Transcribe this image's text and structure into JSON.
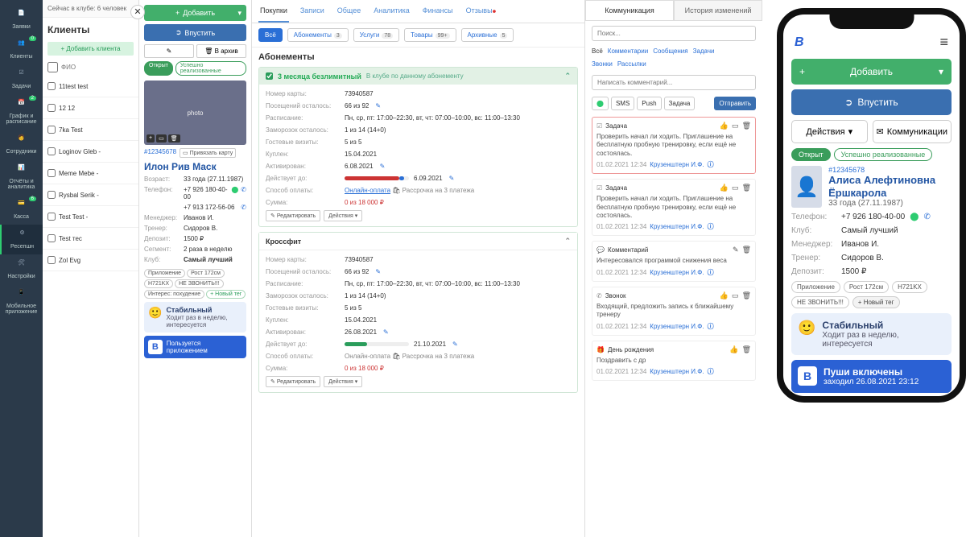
{
  "sidebar": {
    "items": [
      {
        "label": "Заявки",
        "badge": ""
      },
      {
        "label": "Клиенты",
        "badge": "0"
      },
      {
        "label": "Задачи",
        "badge": ""
      },
      {
        "label": "График и расписание",
        "badge": "2"
      },
      {
        "label": "Сотрудники",
        "badge": ""
      },
      {
        "label": "Отчёты и аналитика",
        "badge": ""
      },
      {
        "label": "Касса",
        "badge": "6"
      },
      {
        "label": "Ресепшн",
        "badge": ""
      },
      {
        "label": "Настройки",
        "badge": ""
      },
      {
        "label": "Мобильное приложение",
        "badge": ""
      }
    ]
  },
  "club_line": "Сейчас в клубе: 6 человек",
  "clients": {
    "title": "Клиенты",
    "add_btn": "+ Добавить клиента",
    "fio_label": "ФИО",
    "list": [
      "11test test",
      "12 12",
      "7ka Test",
      "Loginov Gleb -",
      "Meme Mebe -",
      "Rysbal Serik -",
      "Test Test -",
      "Test тес",
      "Zol Evg"
    ]
  },
  "profile": {
    "add": "Добавить",
    "admit": "Впустить",
    "archive_btn": "В архив",
    "status_open": "Открыт",
    "status_impl": "Успешно реализованные",
    "id": "#12345678",
    "bind_card": "Привязать карту",
    "name": "Илон Рив Маск",
    "kv": [
      {
        "k": "Возраст:",
        "v": "33 года (27.11.1987)"
      },
      {
        "k": "Телефон:",
        "v": "+7 926 180-40-00"
      },
      {
        "k": "",
        "v": "+7 913 172-56-06"
      },
      {
        "k": "Менеджер:",
        "v": "Иванов И."
      },
      {
        "k": "Тренер:",
        "v": "Сидоров В."
      },
      {
        "k": "Депозит:",
        "v": "1500 ₽"
      },
      {
        "k": "Сегмент:",
        "v": "2 раза в неделю"
      },
      {
        "k": "Клуб:",
        "v": "Самый лучший"
      }
    ],
    "tags": [
      "Приложение",
      "Рост 172см",
      "H721KX",
      "НЕ ЗВОНИТЬ!!!",
      "Интерес: похудение"
    ],
    "add_tag": "+ Новый тег",
    "status_card": {
      "title": "Стабильный",
      "sub": "Ходит раз в неделю, интересуется"
    },
    "app_card": {
      "title": "Пользуется приложением"
    }
  },
  "center": {
    "tabs": [
      "Покупки",
      "Записи",
      "Общее",
      "Аналитика",
      "Финансы",
      "Отзывы"
    ],
    "pills": [
      {
        "l": "Всё",
        "c": ""
      },
      {
        "l": "Абонементы",
        "c": "3"
      },
      {
        "l": "Услуги",
        "c": "78"
      },
      {
        "l": "Товары",
        "c": "99+"
      },
      {
        "l": "Архивные",
        "c": "5"
      }
    ],
    "section": "Абонементы",
    "abon1": {
      "title": "3 месяца безлимитный",
      "sub": "В клубе по данному абонементу",
      "rows": [
        {
          "k": "Номер карты:",
          "v": "73940587"
        },
        {
          "k": "Посещений осталось:",
          "v": "66 из 92"
        },
        {
          "k": "Расписание:",
          "v": "Пн, ср, пт: 17:00–22:30, вт, чт: 07:00–10:00, вс: 11:00–13:30"
        },
        {
          "k": "Заморозок осталось:",
          "v": "1 из 14 (14+0)"
        },
        {
          "k": "Гостевые визиты:",
          "v": "5 из 5"
        },
        {
          "k": "Куплен:",
          "v": "15.04.2021"
        },
        {
          "k": "Активирован:",
          "v": "6.08.2021"
        },
        {
          "k": "Действует до:",
          "v": "6.09.2021"
        },
        {
          "k": "Способ оплаты:",
          "v": "Онлайн-оплата",
          "extra": "Рассрочка на 3 платежа"
        },
        {
          "k": "Сумма:",
          "v": "0 из 18 000 ₽"
        }
      ],
      "edit": "Редактировать",
      "actions": "Действия"
    },
    "abon2": {
      "title": "Кроссфит",
      "rows": [
        {
          "k": "Номер карты:",
          "v": "73940587"
        },
        {
          "k": "Посещений осталось:",
          "v": "66 из 92"
        },
        {
          "k": "Расписание:",
          "v": "Пн, ср, пт: 17:00–22:30, вт, чт: 07:00–10:00, вс: 11:00–13:30"
        },
        {
          "k": "Заморозок осталось:",
          "v": "1 из 14 (14+0)"
        },
        {
          "k": "Гостевые визиты:",
          "v": "5 из 5"
        },
        {
          "k": "Куплен:",
          "v": "15.04.2021"
        },
        {
          "k": "Активирован:",
          "v": "26.08.2021"
        },
        {
          "k": "Действует до:",
          "v": "21.10.2021"
        },
        {
          "k": "Способ оплаты:",
          "v": "Онлайн-оплата",
          "extra": "Рассрочка на 3 платежа"
        },
        {
          "k": "Сумма:",
          "v": "0 из 18 000 ₽"
        }
      ],
      "edit": "Редактировать",
      "actions": "Действия"
    }
  },
  "right": {
    "tabs": [
      "Коммуникация",
      "История изменений"
    ],
    "search_ph": "Поиск...",
    "filters1": [
      "Всё",
      "Комментарии",
      "Сообщения",
      "Задачи"
    ],
    "filters2": [
      "Звонки",
      "Рассылки"
    ],
    "comment_ph": "Написать комментарий...",
    "sendopts": [
      "SMS",
      "Push",
      "Задача"
    ],
    "send": "Отправить",
    "feed": [
      {
        "type": "Задача",
        "body": "Проверить начал ли ходить. Приглашение на бесплатную пробную тренировку, если ещё не состоялась.",
        "meta": "01.02.2021 12:34",
        "who": "Крузенштерн И.Ф.",
        "hl": true
      },
      {
        "type": "Задача",
        "body": "Проверить начал ли ходить. Приглашение на бесплатную пробную тренировку, если ещё не состоялась.",
        "meta": "01.02.2021 12:34",
        "who": "Крузенштерн И.Ф."
      },
      {
        "type": "Комментарий",
        "body": "Интересовался программой снижения веса",
        "meta": "01.02.2021 12:34",
        "who": "Крузенштерн И.Ф."
      },
      {
        "type": "Звонок",
        "body": "Входящий, предложить запись к ближайшему тренеру",
        "meta": "01.02.2021 12:34",
        "who": "Крузенштерн И.Ф."
      },
      {
        "type": "День рождения",
        "body": "Поздравить с др",
        "meta": "01.02.2021 12:34",
        "who": "Крузенштерн И.Ф."
      }
    ]
  },
  "phone": {
    "add": "Добавить",
    "admit": "Впустить",
    "actions": "Действия",
    "comm": "Коммуникации",
    "status_open": "Открыт",
    "status_impl": "Успешно реализованные",
    "id": "#12345678",
    "name": "Алиса Алефтиновна Ёршкарола",
    "age": "33 года (27.11.1987)",
    "kv": [
      {
        "k": "Телефон:",
        "v": "+7 926 180-40-00"
      },
      {
        "k": "Клуб:",
        "v": "Самый лучший"
      },
      {
        "k": "Менеджер:",
        "v": "Иванов И."
      },
      {
        "k": "Тренер:",
        "v": "Сидоров В."
      },
      {
        "k": "Депозит:",
        "v": "1500 ₽"
      }
    ],
    "tags": [
      "Приложение",
      "Рост 172см",
      "H721KX",
      "НЕ ЗВОНИТЬ!!!"
    ],
    "add_tag": "+ Новый тег",
    "status": {
      "title": "Стабильный",
      "sub": "Ходит раз в неделю, интересуется"
    },
    "push": {
      "title": "Пуши включены",
      "sub": "заходил 26.08.2021 23:12"
    }
  }
}
